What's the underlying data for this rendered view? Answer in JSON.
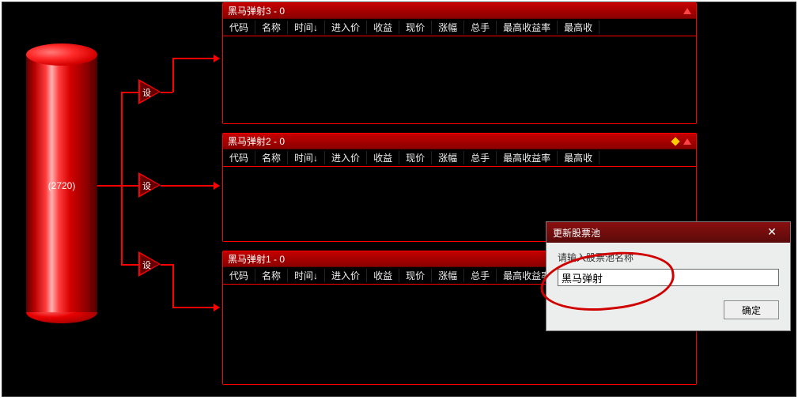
{
  "cylinder": {
    "label": "(2720)"
  },
  "nodes": {
    "label": "设"
  },
  "columns": [
    "代码",
    "名称",
    "时间↓",
    "进入价",
    "收益",
    "现价",
    "涨幅",
    "总手",
    "最高收益率",
    "最高收"
  ],
  "panels": [
    {
      "title": "黑马弹射3 - 0",
      "showDiamond": false
    },
    {
      "title": "黑马弹射2 - 0",
      "showDiamond": true
    },
    {
      "title": "黑马弹射1 - 0",
      "showDiamond": false
    }
  ],
  "dialog": {
    "title": "更新股票池",
    "prompt": "请输入股票池名称",
    "value": "黑马弹射",
    "ok": "确定"
  },
  "colors": {
    "accent": "#ff0000",
    "panelHeader": "#8a0000",
    "dialogHeader": "#6a0d0d"
  }
}
